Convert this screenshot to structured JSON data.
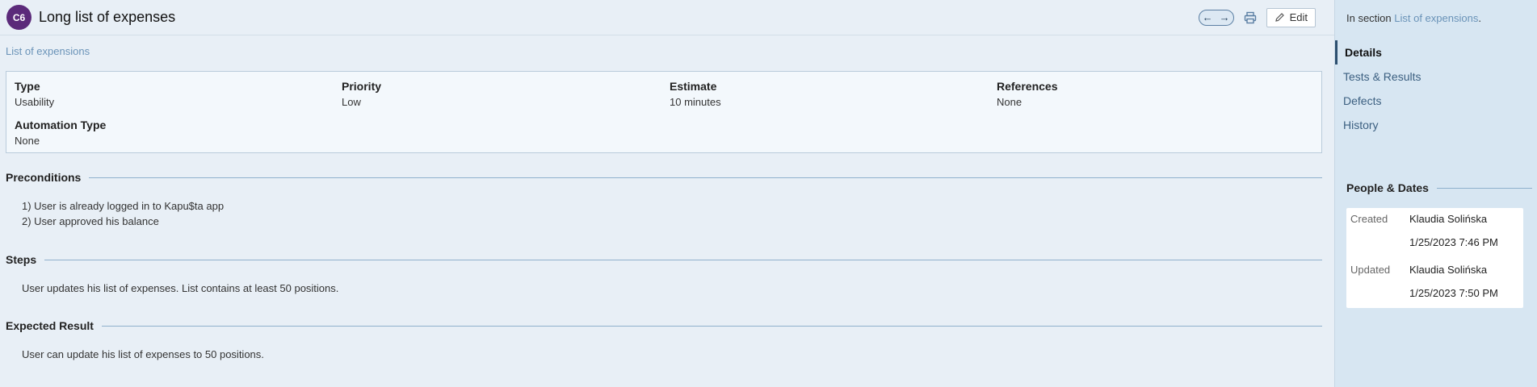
{
  "header": {
    "case_id": "C6",
    "title": "Long list of expenses",
    "edit_label": "Edit"
  },
  "breadcrumb": "List of expensions",
  "fields": {
    "type_label": "Type",
    "type_value": "Usability",
    "priority_label": "Priority",
    "priority_value": "Low",
    "estimate_label": "Estimate",
    "estimate_value": "10 minutes",
    "references_label": "References",
    "references_value": "None",
    "automation_label": "Automation Type",
    "automation_value": "None"
  },
  "preconditions": {
    "title": "Preconditions",
    "lines": [
      "1) User is already logged in to Kapu$ta app",
      "2) User approved his balance"
    ]
  },
  "steps": {
    "title": "Steps",
    "text": "User updates his list of expenses. List contains at least 50 positions."
  },
  "expected": {
    "title": "Expected Result",
    "text": "User can update his list of expenses to 50 positions."
  },
  "sidebar": {
    "in_section_prefix": "In section ",
    "in_section_link": "List of expensions",
    "in_section_suffix": ".",
    "nav": [
      "Details",
      "Tests & Results",
      "Defects",
      "History"
    ],
    "people_dates_title": "People & Dates",
    "created_label": "Created",
    "created_by": "Klaudia Solińska",
    "created_date": "1/25/2023 7:46 PM",
    "updated_label": "Updated",
    "updated_by": "Klaudia Solińska",
    "updated_date": "1/25/2023 7:50 PM"
  },
  "colors": {
    "badge": "#5b2a7a",
    "link": "#6a93b8",
    "sidebar_bg": "#d7e6f2"
  }
}
